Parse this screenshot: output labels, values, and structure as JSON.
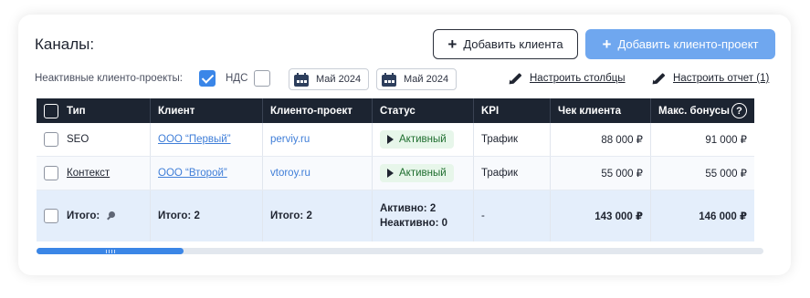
{
  "header": {
    "title": "Каналы:",
    "add_client_label": "Добавить клиента",
    "add_client_project_label": "Добавить клиенто-проект"
  },
  "filters": {
    "inactive_label": "Неактивные клиенто-проекты:",
    "inactive_checked": true,
    "vat_label": "НДС",
    "vat_checked": false,
    "date_from": "Май 2024",
    "date_to": "Май 2024",
    "configure_columns": "Настроить столбцы",
    "configure_report": "Настроить отчет (1)"
  },
  "table": {
    "columns": [
      "Тип",
      "Клиент",
      "Клиенто-проект",
      "Статус",
      "KPI",
      "Чек клиента",
      "Макс. бонусы"
    ],
    "rows": [
      {
        "type": "SEO",
        "client": "ООО “Первый”",
        "project": "perviy.ru",
        "status": "Активный",
        "kpi": "Трафик",
        "check": "88 000 ₽",
        "bonus": "91 000 ₽"
      },
      {
        "type": "Контекст",
        "client": "ООО “Второй”",
        "project": "vtoroy.ru",
        "status": "Активный",
        "kpi": "Трафик",
        "check": "55 000 ₽",
        "bonus": "55 000 ₽"
      }
    ],
    "total": {
      "label": "Итого:",
      "clients": "Итого: 2",
      "projects": "Итого: 2",
      "active": "Активно: 2",
      "inactive": "Неактивно: 0",
      "kpi": "-",
      "check": "143 000 ₽",
      "bonus": "146 000 ₽"
    },
    "help_symbol": "?"
  },
  "colors": {
    "primary": "#6fa7ef",
    "header_bg": "#1c2431",
    "total_bg": "#e4eefb",
    "link": "#3f7ed8",
    "active_badge_bg": "#e7f6ea",
    "scroll_thumb": "#3b86e6"
  },
  "icons": [
    "plus-icon",
    "calendar-icon",
    "pencil-icon",
    "help-icon",
    "pin-icon",
    "play-icon"
  ],
  "scroll": {
    "position_fraction": 0.0,
    "visible_fraction": 0.2
  }
}
